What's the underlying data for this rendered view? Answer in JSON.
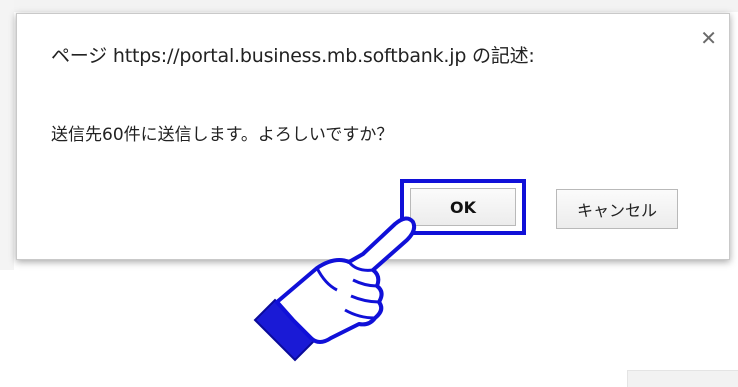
{
  "dialog": {
    "title": "ページ https://portal.business.mb.softbank.jp の記述:",
    "message": "送信先60件に送信します。よろしいですか？",
    "close_icon": "close-icon",
    "ok_label": "OK",
    "cancel_label": "キャンセル"
  },
  "colors": {
    "highlight": "#1010d8",
    "hand_fill": "#1a1ad6"
  },
  "icons": {
    "pointer": "pointing-hand-icon"
  }
}
